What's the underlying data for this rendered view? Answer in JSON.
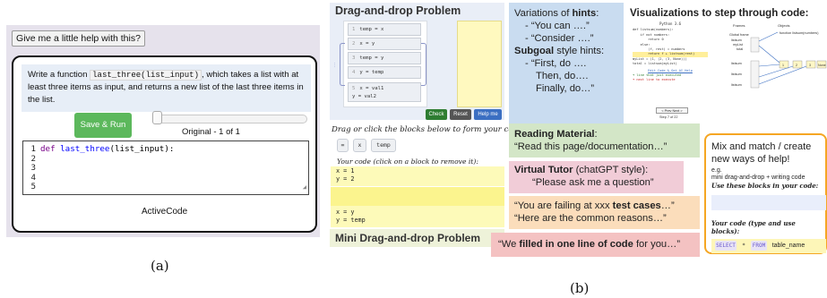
{
  "panel_a": {
    "help_button": "Give me a little help with this?",
    "prompt_before": "Write a function ",
    "prompt_code": "last_three(list_input)",
    "prompt_after": ", which takes a list with at least three items as input, and returns a new list of the last three items in the list.",
    "save_run": "Save & Run",
    "version": "Original - 1 of 1",
    "line_numbers": [
      "1",
      "2",
      "3",
      "4",
      "5"
    ],
    "code_kw": "def ",
    "code_fn": "last_three",
    "code_rest": "(list_input):",
    "footer": "ActiveCode",
    "caption": "(a)"
  },
  "drag_drop": {
    "title": "Drag-and-drop Problem",
    "blocks": [
      {
        "n": "1",
        "code": "temp = x"
      },
      {
        "n": "2",
        "code": "x = y"
      },
      {
        "n": "3",
        "code": "temp = y"
      },
      {
        "n": "4",
        "code": "y = temp"
      },
      {
        "n": "5",
        "code": "x = val1\ny = val2"
      }
    ],
    "buttons": {
      "check": "Check",
      "reset": "Reset",
      "help": "Help me"
    }
  },
  "mini": {
    "instruction": "Drag or click the blocks below to form your code:",
    "chips": [
      "=",
      "x",
      "temp"
    ],
    "your_code_label": "Your code (click on a block to remove it):",
    "code_top": "x = 1\ny = 2",
    "code_bottom": "x = y\ny = temp",
    "title": "Mini Drag-and-drop Problem"
  },
  "hints": {
    "l1_a": "Variations of ",
    "l1_b": "hints",
    "l1_c": ":",
    "l2": "-   “You can ….”",
    "l3": "-   “Consider ….”",
    "l4_a": "Subgoal",
    "l4_b": " style hints:",
    "l5": "-   “First, do ….",
    "l6": "Then, do….",
    "l7": "Finally, do…”"
  },
  "viz": {
    "title": "Visualizations to step through code:",
    "header": "Python 3.6",
    "code": [
      "def listsum(numbers):",
      "    if not numbers:",
      "        return 0",
      "    else:",
      "        (f, rest) = numbers",
      "        return f + listsum(rest)",
      "",
      "myList = (1, (2, (3, None)))",
      "total = listsum(myList)"
    ],
    "link": "Edit Code & Get AI Help",
    "legend1": "line that just executed",
    "legend2": "next line to execute",
    "nav_prev": "< Prev",
    "nav_next": "Next >",
    "step": "Step 7 of 22",
    "frames_label": "Frames",
    "objects_label": "Objects",
    "frame_rows": [
      "Global frame",
      "listsum",
      "listsum",
      "listsum"
    ],
    "frame_vars": [
      "listsum",
      "myList",
      "total"
    ],
    "tuple_vals": [
      "1",
      "2",
      "3",
      "None"
    ],
    "fn_label": "function listsum(numbers)"
  },
  "reading": {
    "a": "Reading Material",
    "b": ":",
    "c": "“Read this page/documentation…”"
  },
  "vtutor": {
    "a": "Virtual Tutor",
    "b": " (chatGPT style):",
    "c": "“Please ask me a question”"
  },
  "failing": {
    "a": "“You are failing at xxx ",
    "b": "test cases",
    "c": "…”",
    "d": "“Here are the common reasons…”"
  },
  "filled": {
    "a": "“We ",
    "b": "filled in one line of code",
    "c": " for you…”"
  },
  "mixmatch": {
    "title": "Mix and match / create new ways of help!",
    "eg1": "e.g.",
    "eg2": "mini drag-and-drop + writing code",
    "use": "Use these blocks in your code:",
    "yours": "Your code (type and use blocks):",
    "chips": [
      "SELECT",
      "*",
      "FROM"
    ],
    "table": "table_name"
  },
  "caption_b": "(b)"
}
